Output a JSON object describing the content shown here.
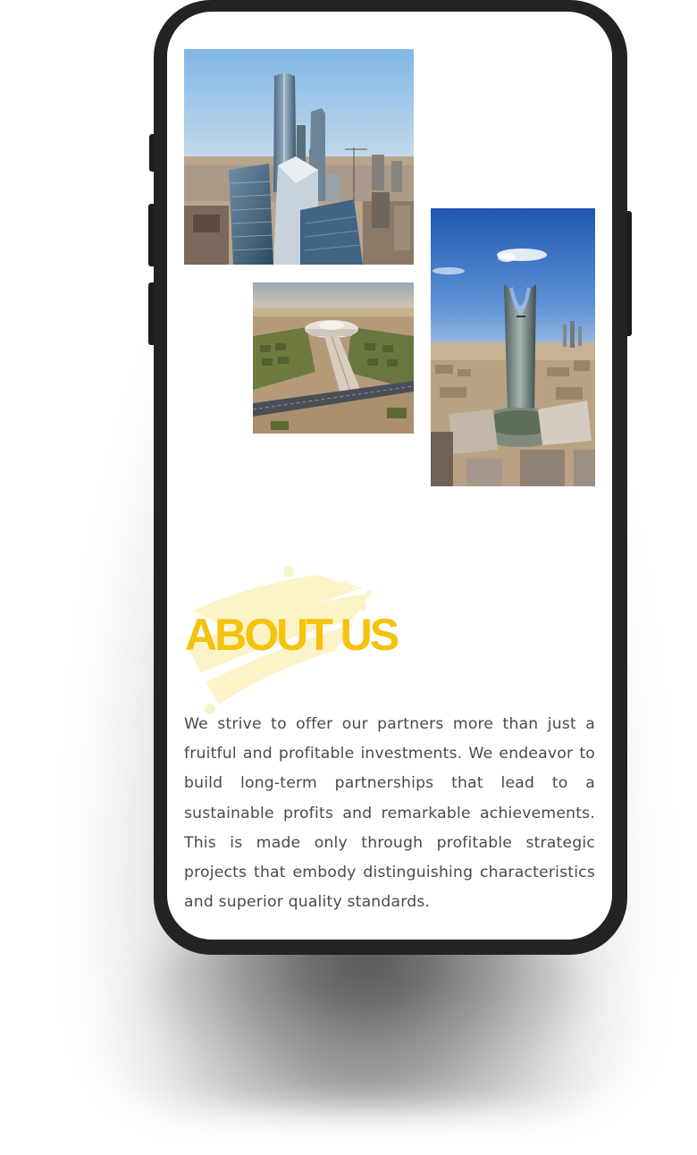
{
  "about": {
    "title": "ABOUT US",
    "body": "We strive to offer our partners more than just a fruitful and profitable investments. We endeavor to build long-term partnerships that lead to a sustainable profits and remarkable achievements. This is made only through profitable strategic projects that embody distinguishing characteristics and superior quality standards."
  },
  "colors": {
    "accent": "#f5c20c",
    "accent_light": "#fdf3c9",
    "body_text": "#4a4a4a",
    "phone_frame": "#232323"
  }
}
